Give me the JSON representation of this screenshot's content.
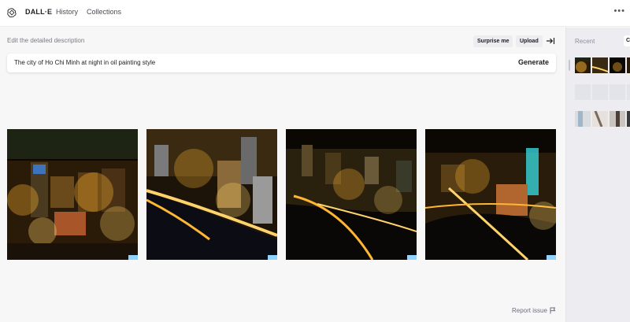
{
  "nav": {
    "brand": "DALL·E",
    "links": [
      "History",
      "Collections"
    ],
    "more": "•••"
  },
  "prompt": {
    "label": "Edit the detailed description",
    "surprise_label": "Surprise me",
    "upload_label": "Upload",
    "value": "The city of Ho Chi Minh at night in oil painting style",
    "generate_label": "Generate"
  },
  "results": {
    "images": [
      {
        "name": "generated-image-1",
        "alt": "city at night variation 1"
      },
      {
        "name": "generated-image-2",
        "alt": "city at night variation 2"
      },
      {
        "name": "generated-image-3",
        "alt": "city at night variation 3"
      },
      {
        "name": "generated-image-4",
        "alt": "city at night variation 4"
      }
    ],
    "report_label": "Report issue"
  },
  "sidebar": {
    "recent_label": "Recent",
    "clear_label": "C"
  },
  "colors": {
    "background": "#f7f7f8",
    "sidebar": "#ececf1",
    "night_sky": "#0b0804",
    "city_light": "#ffb733",
    "river_light": "#ffd36b",
    "neon_cyan": "#38e0e8"
  },
  "icons": [
    "openai-logo-icon",
    "more-options-icon",
    "panel-collapse-icon",
    "flag-icon"
  ]
}
